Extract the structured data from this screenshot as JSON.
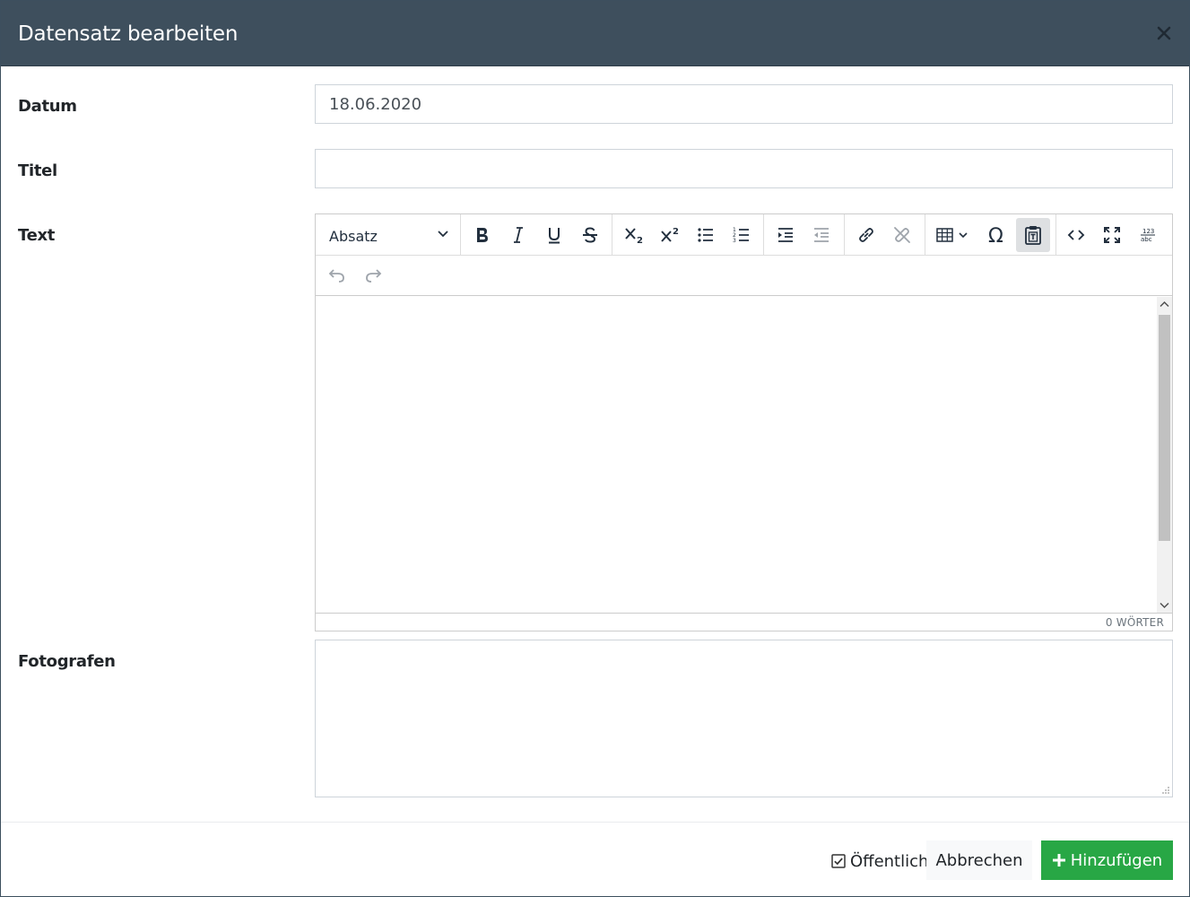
{
  "dialog": {
    "title": "Datensatz bearbeiten",
    "close_icon": "close-icon"
  },
  "fields": {
    "datum": {
      "label": "Datum",
      "value": "18.06.2020"
    },
    "titel": {
      "label": "Titel",
      "value": ""
    },
    "text": {
      "label": "Text"
    },
    "fotografen": {
      "label": "Fotografen",
      "value": ""
    }
  },
  "editor": {
    "block_format": "Absatz",
    "toolbar_icons": [
      "bold-icon",
      "italic-icon",
      "underline-icon",
      "strikethrough-icon",
      "subscript-icon",
      "superscript-icon",
      "bullet-list-icon",
      "numbered-list-icon",
      "indent-icon",
      "outdent-icon",
      "link-icon",
      "unlink-icon",
      "table-icon",
      "special-character-icon",
      "paste-as-text-icon",
      "source-code-icon",
      "fullscreen-icon",
      "word-count-icon",
      "undo-icon",
      "redo-icon"
    ],
    "word_count": "0 WÖRTER"
  },
  "footer": {
    "public_label": "Öffentlich",
    "public_checked": true,
    "cancel_label": "Abbrechen",
    "add_label": "Hinzufügen"
  },
  "colors": {
    "header_bg": "#3e4f5d",
    "primary_green": "#28a745"
  }
}
